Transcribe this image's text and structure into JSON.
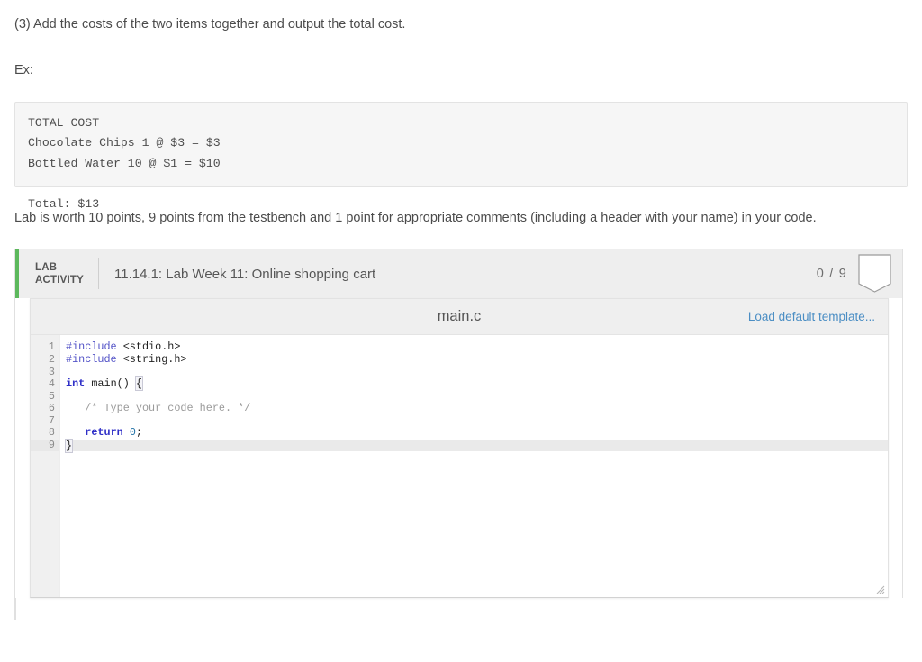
{
  "instructions": {
    "step3": "(3) Add the costs of the two items together and output the total cost.",
    "ex_label": "Ex:",
    "example_output": "TOTAL COST\nChocolate Chips 1 @ $3 = $3\nBottled Water 10 @ $1 = $10\n\nTotal: $13",
    "grading_note": "Lab is worth 10 points, 9 points from the testbench and 1 point for appropriate comments (including a header with your name) in your code."
  },
  "lab_activity": {
    "badge_line1": "LAB",
    "badge_line2": "ACTIVITY",
    "title": "11.14.1: Lab Week 11: Online shopping cart",
    "score": "0 / 9",
    "score_earned": "0",
    "score_total": "9",
    "accent_color": "#5cb85c"
  },
  "editor": {
    "file_name": "main.c",
    "load_template_label": "Load default template...",
    "link_color": "#4b8ec4",
    "line_numbers": [
      "1",
      "2",
      "3",
      "4",
      "5",
      "6",
      "7",
      "8",
      "9"
    ],
    "active_line": "9",
    "code_lines": [
      {
        "n": "1",
        "segments": [
          {
            "t": "#include ",
            "c": "tok-pre"
          },
          {
            "t": "<stdio.h>",
            "c": "tok-plain"
          }
        ]
      },
      {
        "n": "2",
        "segments": [
          {
            "t": "#include ",
            "c": "tok-pre"
          },
          {
            "t": "<string.h>",
            "c": "tok-plain"
          }
        ]
      },
      {
        "n": "3",
        "segments": []
      },
      {
        "n": "4",
        "segments": [
          {
            "t": "int",
            "c": "tok-kw"
          },
          {
            "t": " main() ",
            "c": "tok-plain"
          },
          {
            "t": "{",
            "c": "tok-plain brace-match"
          }
        ]
      },
      {
        "n": "5",
        "segments": []
      },
      {
        "n": "6",
        "segments": [
          {
            "t": "   /* Type your code here. */",
            "c": "tok-comment"
          }
        ]
      },
      {
        "n": "7",
        "segments": []
      },
      {
        "n": "8",
        "segments": [
          {
            "t": "   ",
            "c": "tok-plain"
          },
          {
            "t": "return",
            "c": "tok-kw"
          },
          {
            "t": " ",
            "c": "tok-plain"
          },
          {
            "t": "0",
            "c": "tok-num"
          },
          {
            "t": ";",
            "c": "tok-plain"
          }
        ]
      },
      {
        "n": "9",
        "segments": [
          {
            "t": "}",
            "c": "tok-plain brace-match"
          }
        ],
        "caret": true,
        "active": true
      }
    ]
  }
}
